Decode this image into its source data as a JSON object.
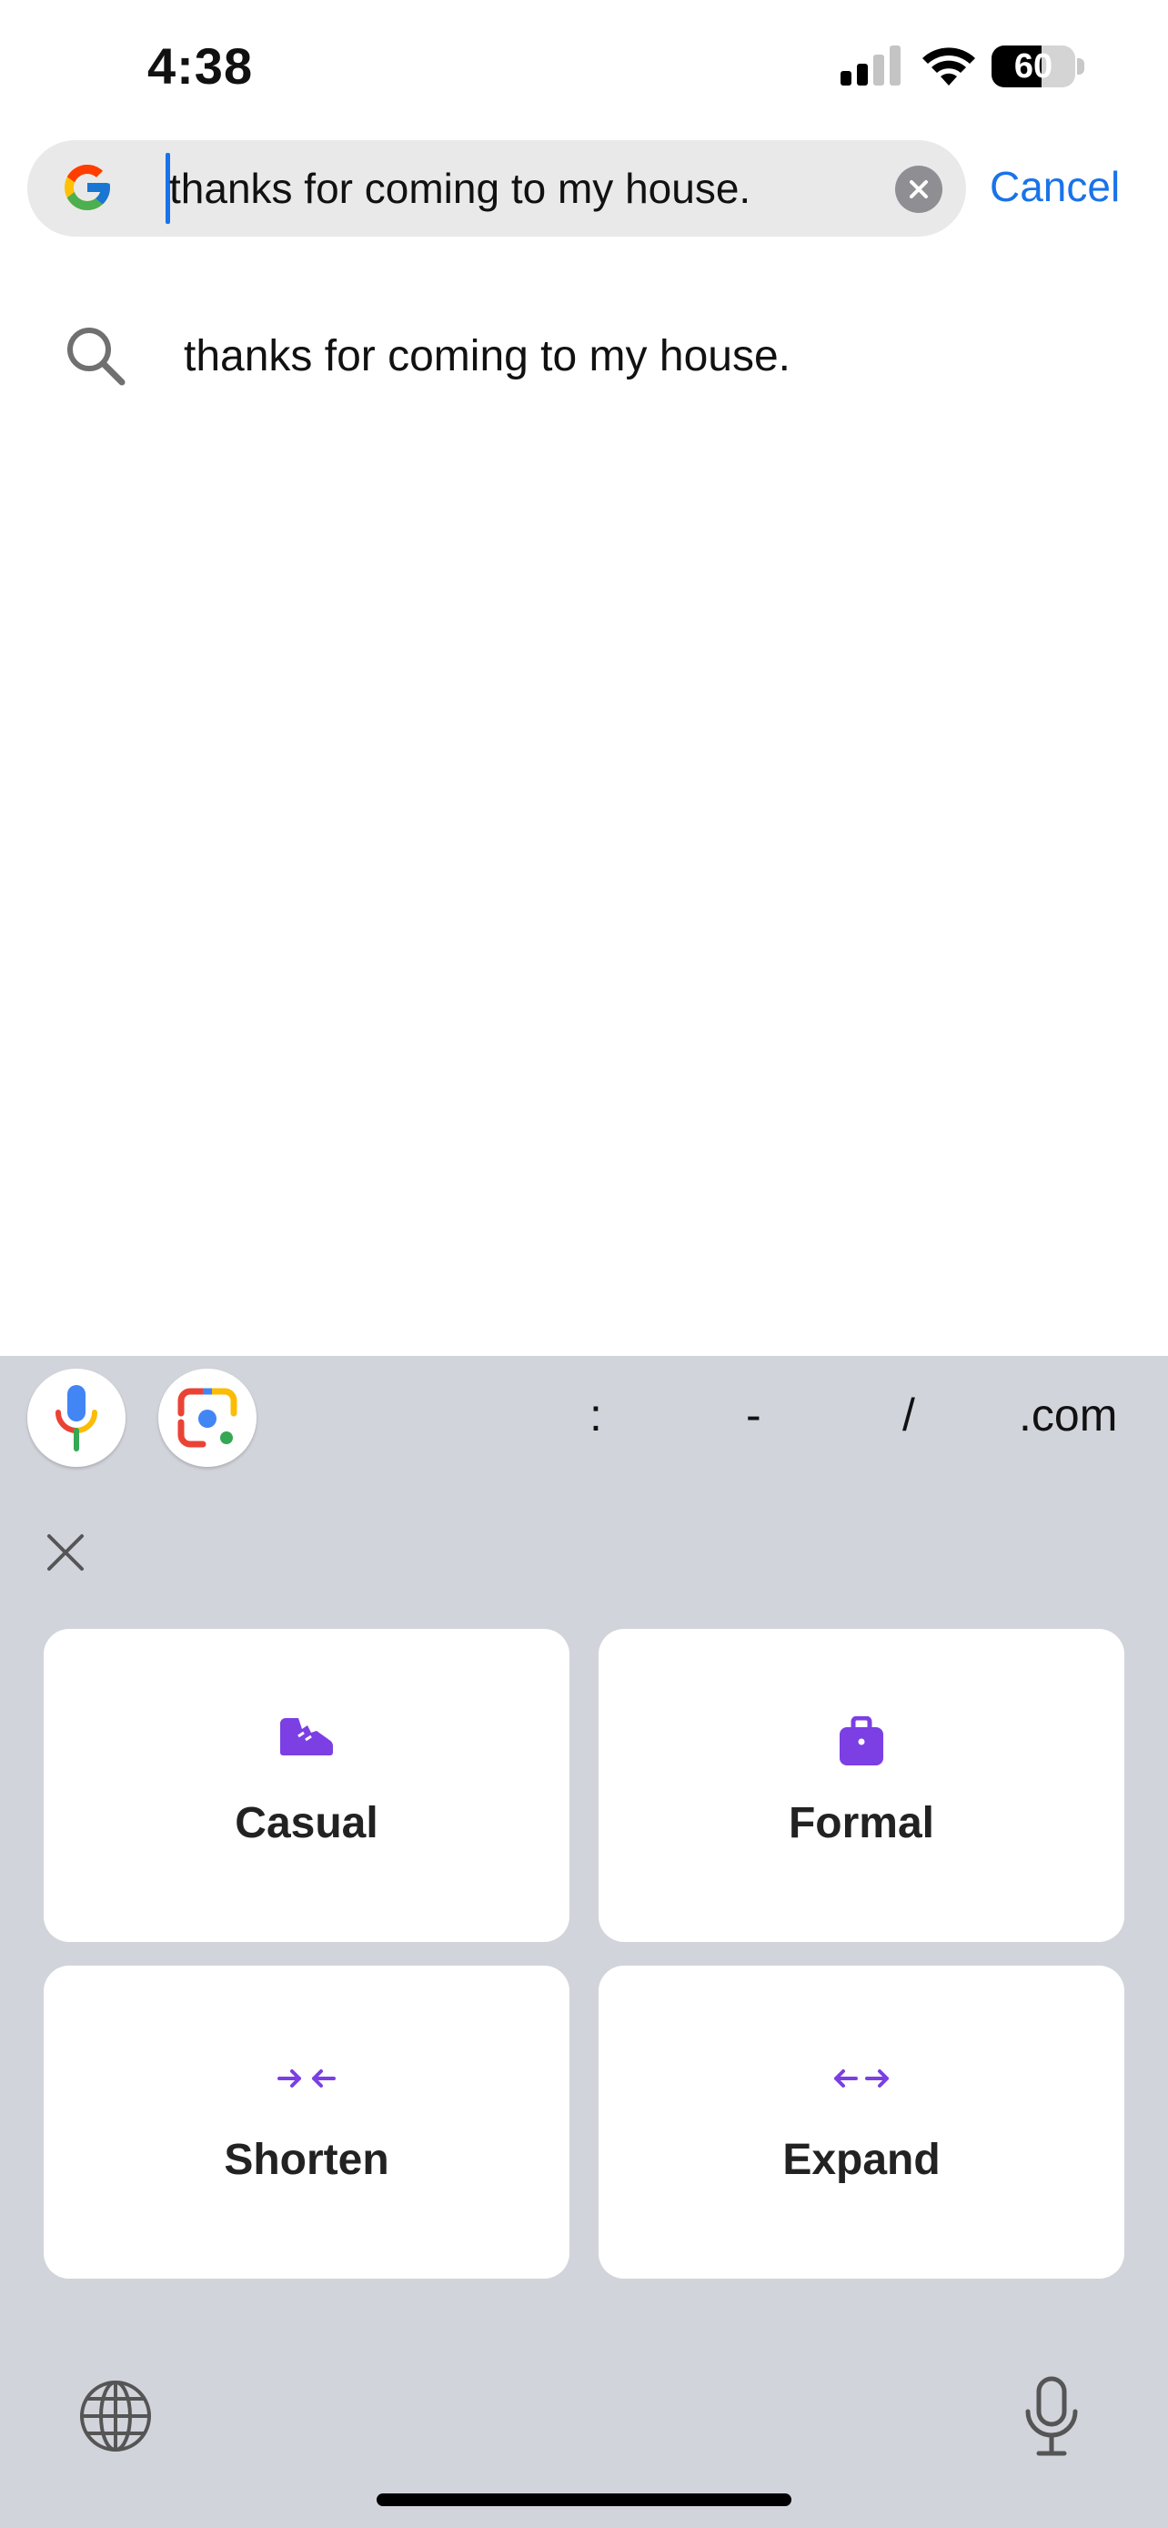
{
  "status_bar": {
    "time": "4:38",
    "battery_level": "60",
    "battery_fraction": 0.6,
    "icons": [
      "cellular-signal-icon",
      "wifi-icon",
      "battery-icon"
    ]
  },
  "search": {
    "query": "thanks for coming to my house.",
    "cancel_label": "Cancel",
    "logo_icon": "google-g-icon",
    "clear_icon": "clear-icon"
  },
  "suggestions": [
    {
      "icon": "search-icon",
      "text": "thanks for coming to my house."
    }
  ],
  "keyboard": {
    "toolbar": {
      "icons": [
        "google-voice-mic-icon",
        "google-lens-icon"
      ],
      "punctuation": [
        ":",
        "-",
        "/",
        ".com"
      ]
    },
    "rewrite_panel": {
      "close_icon": "close-icon",
      "options": [
        {
          "label": "Casual",
          "icon": "sneaker-icon"
        },
        {
          "label": "Formal",
          "icon": "briefcase-icon"
        },
        {
          "label": "Shorten",
          "icon": "arrows-inward-icon"
        },
        {
          "label": "Expand",
          "icon": "arrows-outward-icon"
        }
      ]
    },
    "bottom_icons": [
      "globe-icon",
      "dictation-mic-icon"
    ]
  },
  "colors": {
    "accent_blue": "#1a73e8",
    "purple": "#7b3fe4",
    "keyboard_bg": "#d1d4db",
    "search_bg": "#e9e9ea"
  }
}
